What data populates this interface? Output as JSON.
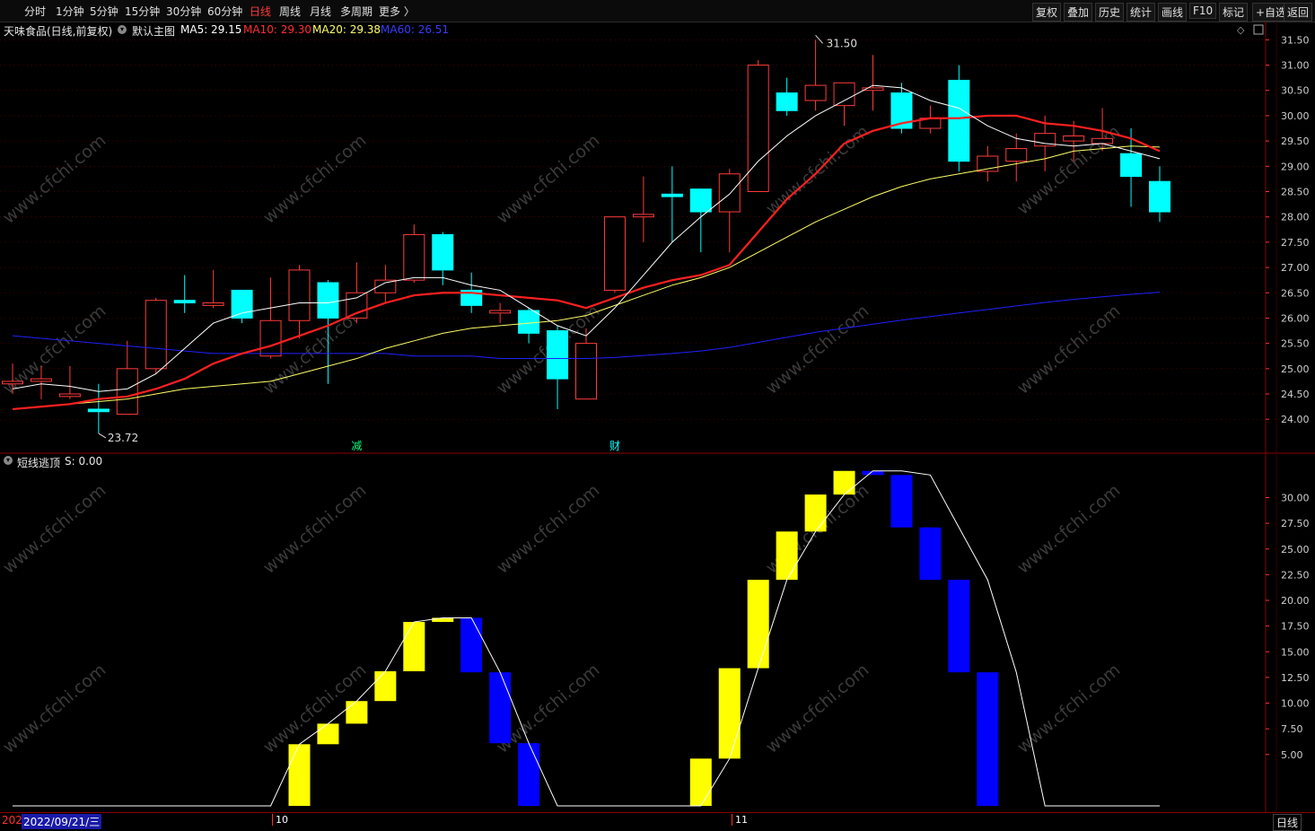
{
  "toolbar": {
    "periods": [
      "分时",
      "1分钟",
      "5分钟",
      "15分钟",
      "30分钟",
      "60分钟",
      "日线",
      "周线",
      "月线",
      "多周期",
      "更多 〉"
    ],
    "active_period": "日线",
    "right_buttons": [
      "复权",
      "叠加",
      "历史",
      "统计",
      "画线",
      "F10",
      "标记",
      "+自选",
      "返回"
    ]
  },
  "main_info": {
    "stock": "天味食品(日线,前复权)",
    "template": "默认主图",
    "ma5": "MA5: 29.15",
    "ma10": "MA10: 29.30",
    "ma20": "MA20: 29.38",
    "ma60": "MA60: 26.51"
  },
  "indicator_info": {
    "name": "短线逃顶",
    "value": "S: 0.00"
  },
  "date_bar": {
    "prefix": "202",
    "cursor_date": "2022/09/21/三",
    "month_marks": [
      "10",
      "11"
    ],
    "period_label": "日线"
  },
  "markers": {
    "high_label": "31.50",
    "low_label": "23.72",
    "event_1": "减",
    "event_2": "财"
  },
  "colors": {
    "up": "#ff3b3b",
    "down": "#00ffff",
    "ma5": "#ffffff",
    "ma10": "#ff2020",
    "ma20": "#ffff66",
    "ma60": "#2020ff",
    "ind_up": "#ffff00",
    "ind_down": "#0000ff",
    "grid": "#8b0000",
    "watermark": "www.cfchi.com"
  },
  "chart_data": [
    {
      "type": "candlestick",
      "title": "天味食品(日线,前复权)",
      "y_ticks": [
        24.0,
        24.5,
        25.0,
        25.5,
        26.0,
        26.5,
        27.0,
        27.5,
        28.0,
        28.5,
        29.0,
        29.5,
        30.0,
        30.5,
        31.0,
        31.5
      ],
      "ylim": [
        23.6,
        31.75
      ],
      "grid": true,
      "candles": [
        {
          "o": 24.7,
          "h": 25.1,
          "l": 24.5,
          "c": 24.75
        },
        {
          "o": 24.75,
          "h": 25.05,
          "l": 24.4,
          "c": 24.8
        },
        {
          "o": 24.45,
          "h": 25.05,
          "l": 24.4,
          "c": 24.5
        },
        {
          "o": 24.2,
          "h": 24.7,
          "l": 23.72,
          "c": 24.15
        },
        {
          "o": 24.1,
          "h": 25.55,
          "l": 24.1,
          "c": 25.0
        },
        {
          "o": 25.0,
          "h": 26.4,
          "l": 24.9,
          "c": 26.35
        },
        {
          "o": 26.35,
          "h": 26.85,
          "l": 26.1,
          "c": 26.3
        },
        {
          "o": 26.25,
          "h": 26.95,
          "l": 26.2,
          "c": 26.3
        },
        {
          "o": 26.55,
          "h": 26.55,
          "l": 25.9,
          "c": 26.0
        },
        {
          "o": 25.25,
          "h": 26.8,
          "l": 25.2,
          "c": 25.95
        },
        {
          "o": 25.95,
          "h": 27.05,
          "l": 25.6,
          "c": 26.95
        },
        {
          "o": 26.7,
          "h": 26.75,
          "l": 24.7,
          "c": 26.0
        },
        {
          "o": 26.0,
          "h": 27.1,
          "l": 25.9,
          "c": 26.5
        },
        {
          "o": 26.5,
          "h": 27.05,
          "l": 26.3,
          "c": 26.75
        },
        {
          "o": 26.75,
          "h": 27.85,
          "l": 26.7,
          "c": 27.65
        },
        {
          "o": 27.65,
          "h": 27.7,
          "l": 26.65,
          "c": 26.95
        },
        {
          "o": 26.55,
          "h": 26.9,
          "l": 26.1,
          "c": 26.25
        },
        {
          "o": 26.1,
          "h": 26.3,
          "l": 25.9,
          "c": 26.15
        },
        {
          "o": 26.15,
          "h": 26.2,
          "l": 25.5,
          "c": 25.7
        },
        {
          "o": 25.75,
          "h": 25.85,
          "l": 24.2,
          "c": 24.8
        },
        {
          "o": 24.4,
          "h": 25.8,
          "l": 24.4,
          "c": 25.5
        },
        {
          "o": 26.55,
          "h": 28.0,
          "l": 26.5,
          "c": 28.0
        },
        {
          "o": 28.0,
          "h": 28.8,
          "l": 27.5,
          "c": 28.05
        },
        {
          "o": 28.45,
          "h": 29.0,
          "l": 27.5,
          "c": 28.4
        },
        {
          "o": 28.55,
          "h": 28.55,
          "l": 27.3,
          "c": 28.1
        },
        {
          "o": 28.1,
          "h": 28.95,
          "l": 27.3,
          "c": 28.85
        },
        {
          "o": 28.5,
          "h": 31.1,
          "l": 28.5,
          "c": 31.0
        },
        {
          "o": 30.45,
          "h": 30.75,
          "l": 30.0,
          "c": 30.1
        },
        {
          "o": 30.3,
          "h": 31.5,
          "l": 30.1,
          "c": 30.6
        },
        {
          "o": 30.2,
          "h": 30.6,
          "l": 29.8,
          "c": 30.65
        },
        {
          "o": 30.5,
          "h": 31.2,
          "l": 30.1,
          "c": 30.55
        },
        {
          "o": 30.45,
          "h": 30.65,
          "l": 29.65,
          "c": 29.75
        },
        {
          "o": 29.75,
          "h": 30.2,
          "l": 29.65,
          "c": 29.95
        },
        {
          "o": 30.7,
          "h": 31.0,
          "l": 28.9,
          "c": 29.1
        },
        {
          "o": 28.9,
          "h": 29.4,
          "l": 28.7,
          "c": 29.2
        },
        {
          "o": 29.1,
          "h": 29.65,
          "l": 28.7,
          "c": 29.35
        },
        {
          "o": 29.4,
          "h": 30.0,
          "l": 28.9,
          "c": 29.65
        },
        {
          "o": 29.5,
          "h": 29.9,
          "l": 29.1,
          "c": 29.6
        },
        {
          "o": 29.45,
          "h": 30.15,
          "l": 29.3,
          "c": 29.55
        },
        {
          "o": 29.25,
          "h": 29.75,
          "l": 28.2,
          "c": 28.8
        },
        {
          "o": 28.7,
          "h": 29.0,
          "l": 27.9,
          "c": 28.1
        }
      ],
      "ma5": [
        24.6,
        24.7,
        24.65,
        24.55,
        24.6,
        24.9,
        25.4,
        25.9,
        26.1,
        26.2,
        26.3,
        26.3,
        26.4,
        26.7,
        26.8,
        26.8,
        26.65,
        26.55,
        26.2,
        25.85,
        25.65,
        26.2,
        26.85,
        27.5,
        28.0,
        28.45,
        29.1,
        29.6,
        30.0,
        30.3,
        30.6,
        30.55,
        30.3,
        30.15,
        29.8,
        29.55,
        29.45,
        29.4,
        29.45,
        29.3,
        29.15
      ],
      "ma10": [
        24.2,
        24.25,
        24.3,
        24.4,
        24.45,
        24.6,
        24.8,
        25.1,
        25.3,
        25.45,
        25.65,
        25.85,
        26.1,
        26.3,
        26.45,
        26.5,
        26.5,
        26.45,
        26.4,
        26.35,
        26.2,
        26.4,
        26.6,
        26.75,
        26.85,
        27.05,
        27.7,
        28.35,
        28.85,
        29.45,
        29.7,
        29.85,
        29.95,
        29.95,
        30.0,
        30.0,
        29.85,
        29.8,
        29.7,
        29.55,
        29.3
      ],
      "ma20": [
        24.2,
        24.25,
        24.3,
        24.35,
        24.4,
        24.5,
        24.6,
        24.65,
        24.7,
        24.75,
        24.9,
        25.05,
        25.2,
        25.4,
        25.55,
        25.7,
        25.8,
        25.85,
        25.9,
        25.95,
        26.05,
        26.25,
        26.45,
        26.65,
        26.8,
        27.0,
        27.3,
        27.6,
        27.9,
        28.15,
        28.4,
        28.6,
        28.75,
        28.85,
        28.95,
        29.05,
        29.15,
        29.3,
        29.35,
        29.4,
        29.38
      ],
      "ma60": [
        25.65,
        25.6,
        25.55,
        25.5,
        25.45,
        25.4,
        25.35,
        25.3,
        25.3,
        25.3,
        25.3,
        25.3,
        25.3,
        25.3,
        25.25,
        25.25,
        25.25,
        25.2,
        25.2,
        25.2,
        25.2,
        25.22,
        25.26,
        25.3,
        25.35,
        25.42,
        25.52,
        25.62,
        25.72,
        25.8,
        25.88,
        25.96,
        26.03,
        26.1,
        26.17,
        26.24,
        26.31,
        26.37,
        26.42,
        26.47,
        26.51
      ]
    },
    {
      "type": "bar",
      "title": "短线逃顶",
      "y_ticks": [
        5.0,
        7.5,
        10.0,
        12.5,
        15.0,
        17.5,
        20.0,
        22.5,
        25.0,
        27.5,
        30.0
      ],
      "ylim": [
        0,
        33.5
      ],
      "grid": false,
      "bars": [
        {
          "i": 10,
          "from": 0,
          "to": 6.0,
          "dir": "up"
        },
        {
          "i": 11,
          "from": 6.0,
          "to": 8.0,
          "dir": "up"
        },
        {
          "i": 12,
          "from": 8.0,
          "to": 10.2,
          "dir": "up"
        },
        {
          "i": 13,
          "from": 10.2,
          "to": 13.1,
          "dir": "up"
        },
        {
          "i": 14,
          "from": 13.1,
          "to": 17.9,
          "dir": "up"
        },
        {
          "i": 15,
          "from": 17.9,
          "to": 18.3,
          "dir": "up"
        },
        {
          "i": 16,
          "from": 18.3,
          "to": 13.0,
          "dir": "down"
        },
        {
          "i": 17,
          "from": 13.0,
          "to": 6.1,
          "dir": "down"
        },
        {
          "i": 18,
          "from": 6.1,
          "to": 0,
          "dir": "down"
        },
        {
          "i": 24,
          "from": 0,
          "to": 4.6,
          "dir": "up"
        },
        {
          "i": 25,
          "from": 4.6,
          "to": 13.4,
          "dir": "up"
        },
        {
          "i": 26,
          "from": 13.4,
          "to": 22.0,
          "dir": "up"
        },
        {
          "i": 27,
          "from": 22.0,
          "to": 26.7,
          "dir": "up"
        },
        {
          "i": 28,
          "from": 26.7,
          "to": 30.3,
          "dir": "up"
        },
        {
          "i": 29,
          "from": 30.3,
          "to": 32.6,
          "dir": "up"
        },
        {
          "i": 30,
          "from": 32.6,
          "to": 32.2,
          "dir": "down"
        },
        {
          "i": 31,
          "from": 32.2,
          "to": 27.1,
          "dir": "down"
        },
        {
          "i": 32,
          "from": 27.1,
          "to": 22.0,
          "dir": "down"
        },
        {
          "i": 33,
          "from": 22.0,
          "to": 13.0,
          "dir": "down"
        },
        {
          "i": 34,
          "from": 13.0,
          "to": 0,
          "dir": "down"
        }
      ],
      "line": [
        0,
        0,
        0,
        0,
        0,
        0,
        0,
        0,
        0,
        0,
        6.0,
        8.0,
        10.2,
        13.1,
        17.9,
        18.3,
        18.3,
        13.0,
        6.1,
        0,
        0,
        0,
        0,
        0,
        0,
        4.6,
        13.4,
        22.0,
        26.7,
        30.3,
        32.6,
        32.6,
        32.2,
        27.1,
        22.0,
        13.0,
        0,
        0,
        0,
        0,
        0
      ]
    }
  ]
}
